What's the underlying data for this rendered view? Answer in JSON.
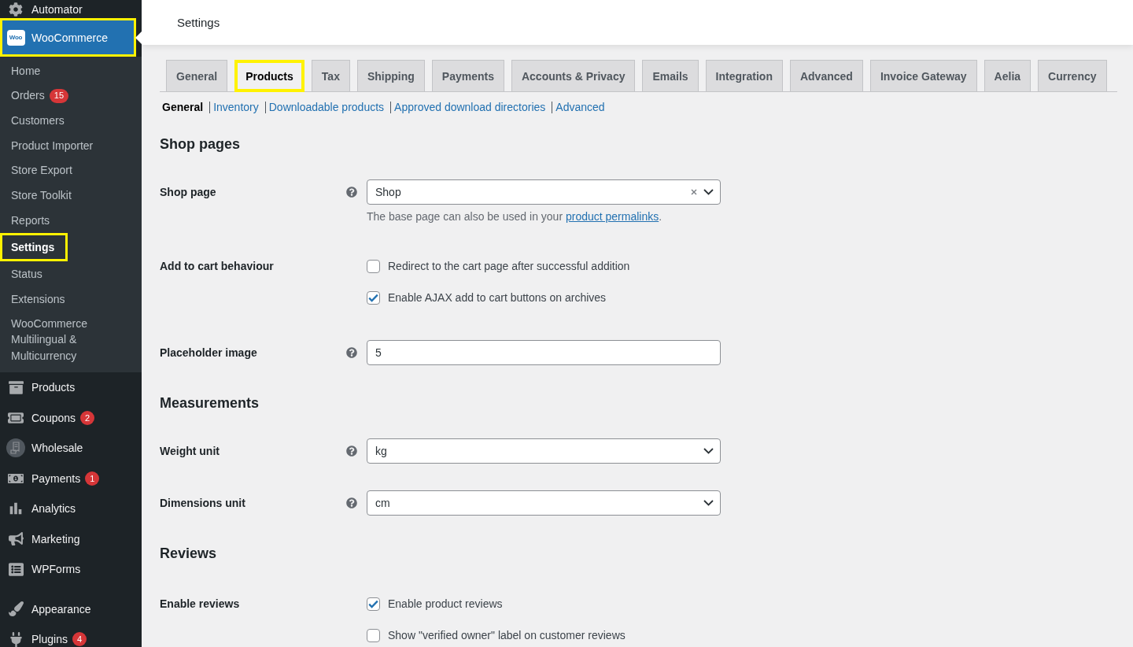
{
  "sidebar": {
    "groups": [
      {
        "items": [
          {
            "label": "Automator",
            "selected": false,
            "highlighted": false
          },
          {
            "label": "WooCommerce",
            "logo_text": "Woo",
            "selected": true,
            "highlighted": true,
            "submenu": [
              {
                "label": "Home",
                "selected": false,
                "highlighted": false
              },
              {
                "label": "Orders",
                "badge": "15",
                "selected": false,
                "highlighted": false
              },
              {
                "label": "Customers",
                "selected": false,
                "highlighted": false
              },
              {
                "label": "Product Importer",
                "selected": false,
                "highlighted": false
              },
              {
                "label": "Store Export",
                "selected": false,
                "highlighted": false
              },
              {
                "label": "Store Toolkit",
                "selected": false,
                "highlighted": false
              },
              {
                "label": "Reports",
                "selected": false,
                "highlighted": false
              },
              {
                "label": "Settings",
                "selected": true,
                "highlighted": true
              },
              {
                "label": "Status",
                "selected": false,
                "highlighted": false
              },
              {
                "label": "Extensions",
                "selected": false,
                "highlighted": false
              },
              {
                "label": "WooCommerce Multilingual & Multicurrency",
                "selected": false,
                "highlighted": false
              }
            ]
          },
          {
            "label": "Products",
            "selected": false,
            "highlighted": false
          },
          {
            "label": "Coupons",
            "badge": "2",
            "selected": false,
            "highlighted": false
          },
          {
            "label": "Wholesale",
            "selected": false,
            "highlighted": false
          },
          {
            "label": "Payments",
            "badge": "1",
            "selected": false,
            "highlighted": false
          },
          {
            "label": "Analytics",
            "selected": false,
            "highlighted": false
          },
          {
            "label": "Marketing",
            "selected": false,
            "highlighted": false
          },
          {
            "label": "WPForms",
            "selected": false,
            "highlighted": false
          }
        ]
      },
      {
        "items": [
          {
            "label": "Appearance",
            "selected": false,
            "highlighted": false
          },
          {
            "label": "Plugins",
            "badge": "4",
            "selected": false,
            "highlighted": false
          }
        ]
      }
    ]
  },
  "header": {
    "title": "Settings"
  },
  "tabs": [
    {
      "label": "General",
      "selected": false,
      "highlighted": false
    },
    {
      "label": "Products",
      "selected": true,
      "highlighted": true
    },
    {
      "label": "Tax",
      "selected": false,
      "highlighted": false
    },
    {
      "label": "Shipping",
      "selected": false,
      "highlighted": false
    },
    {
      "label": "Payments",
      "selected": false,
      "highlighted": false
    },
    {
      "label": "Accounts & Privacy",
      "selected": false,
      "highlighted": false
    },
    {
      "label": "Emails",
      "selected": false,
      "highlighted": false
    },
    {
      "label": "Integration",
      "selected": false,
      "highlighted": false
    },
    {
      "label": "Advanced",
      "selected": false,
      "highlighted": false
    },
    {
      "label": "Invoice Gateway",
      "selected": false,
      "highlighted": false
    },
    {
      "label": "Aelia",
      "selected": false,
      "highlighted": false
    },
    {
      "label": "Currency",
      "selected": false,
      "highlighted": false
    }
  ],
  "subtabs": [
    {
      "label": "General",
      "selected": true
    },
    {
      "label": "Inventory",
      "selected": false
    },
    {
      "label": "Downloadable products",
      "selected": false
    },
    {
      "label": "Approved download directories",
      "selected": false
    },
    {
      "label": "Advanced",
      "selected": false
    }
  ],
  "sections": [
    {
      "title": "Shop pages",
      "fields": [
        {
          "kind": "select",
          "label": "Shop page",
          "help": true,
          "value": "Shop",
          "clearable": true,
          "description": {
            "text": "The base page can also be used in your ",
            "link": "product permalinks",
            "text_after": "."
          }
        },
        {
          "kind": "checkboxes",
          "label": "Add to cart behaviour",
          "help": false,
          "options": [
            {
              "label": "Redirect to the cart page after successful addition",
              "checked": false
            },
            {
              "label": "Enable AJAX add to cart buttons on archives",
              "checked": true
            }
          ]
        },
        {
          "kind": "text",
          "label": "Placeholder image",
          "help": true,
          "value": "5"
        }
      ]
    },
    {
      "title": "Measurements",
      "fields": [
        {
          "kind": "select",
          "label": "Weight unit",
          "help": true,
          "value": "kg",
          "clearable": false
        },
        {
          "kind": "select",
          "label": "Dimensions unit",
          "help": true,
          "value": "cm",
          "clearable": false
        }
      ]
    },
    {
      "title": "Reviews",
      "fields": [
        {
          "kind": "checkboxes",
          "label": "Enable reviews",
          "help": false,
          "options": [
            {
              "label": "Enable product reviews",
              "checked": true
            },
            {
              "label": "Show \"verified owner\" label on customer reviews",
              "checked": false
            }
          ]
        }
      ]
    }
  ]
}
